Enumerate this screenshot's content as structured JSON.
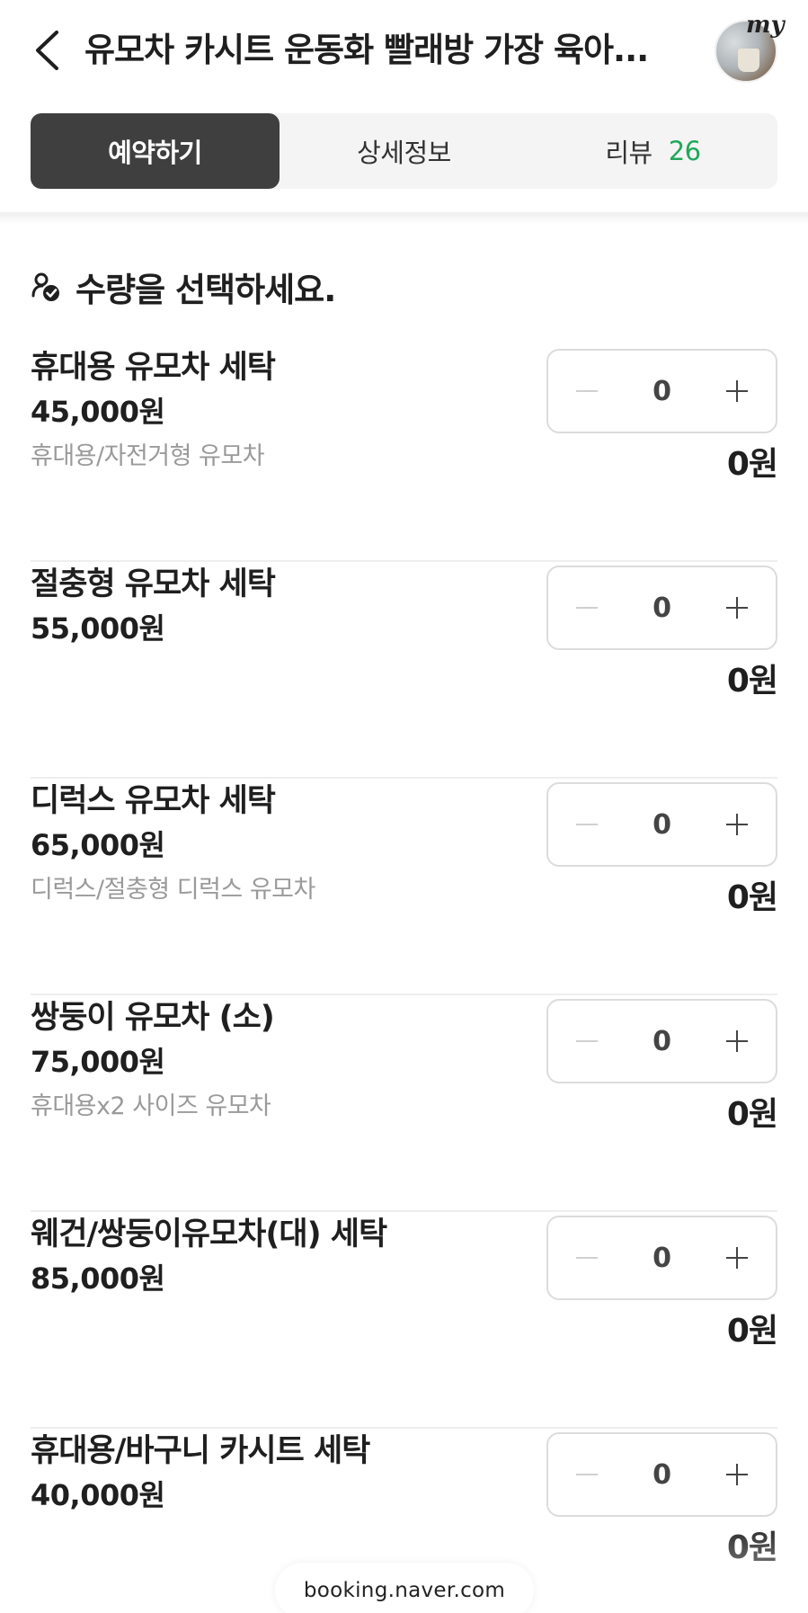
{
  "header": {
    "title": "유모차 카시트 운동화 빨래방 가장 육아...",
    "avatar_badge": "my"
  },
  "tabs": [
    {
      "label": "예약하기",
      "active": true
    },
    {
      "label": "상세정보",
      "active": false
    },
    {
      "label": "리뷰",
      "count": "26",
      "active": false
    }
  ],
  "section": {
    "heading": "수량을 선택하세요."
  },
  "items": [
    {
      "name": "휴대용 유모차 세탁",
      "price": "45,000원",
      "desc": "휴대용/자전거형 유모차",
      "quantity": "0",
      "total": "0원"
    },
    {
      "name": "절충형 유모차 세탁",
      "price": "55,000원",
      "desc": "",
      "quantity": "0",
      "total": "0원"
    },
    {
      "name": "디럭스 유모차 세탁",
      "price": "65,000원",
      "desc": "디럭스/절충형 디럭스 유모차",
      "quantity": "0",
      "total": "0원"
    },
    {
      "name": "쌍둥이 유모차 (소)",
      "price": "75,000원",
      "desc": "휴대용x2 사이즈 유모차",
      "quantity": "0",
      "total": "0원"
    },
    {
      "name": "웨건/쌍둥이유모차(대) 세탁",
      "price": "85,000원",
      "desc": "",
      "quantity": "0",
      "total": "0원"
    },
    {
      "name": "휴대용/바구니 카시트 세탁",
      "price": "40,000원",
      "desc": "",
      "quantity": "0",
      "total": "0원"
    }
  ],
  "browser": {
    "url": "booking.naver.com"
  },
  "colors": {
    "active_tab_bg": "#3f3f3f",
    "review_count": "#1fa85a",
    "muted_text": "#9a9a9a"
  }
}
